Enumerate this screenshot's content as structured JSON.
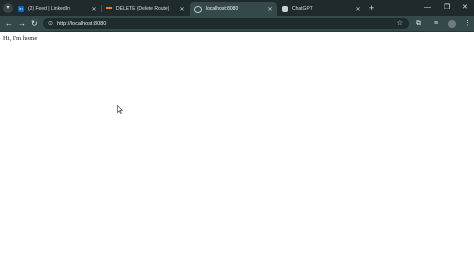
{
  "browser": {
    "tabs": [
      {
        "title": "(2) Feed | LinkedIn",
        "favicon": "linkedin-icon",
        "color": "#0a66c2",
        "active": false
      },
      {
        "title": "DELETE (Delete Route)",
        "favicon": "line-icon",
        "color": "#e57c2f",
        "active": false
      },
      {
        "title": "localhost:8080",
        "favicon": "globe-icon",
        "color": "#b9c2c3",
        "active": true
      },
      {
        "title": "ChatGPT",
        "favicon": "chatgpt-icon",
        "color": "#c9d2d2",
        "active": false
      }
    ],
    "address_url": "http://localhost:8080"
  },
  "page": {
    "text": "Hi, I'm home"
  }
}
